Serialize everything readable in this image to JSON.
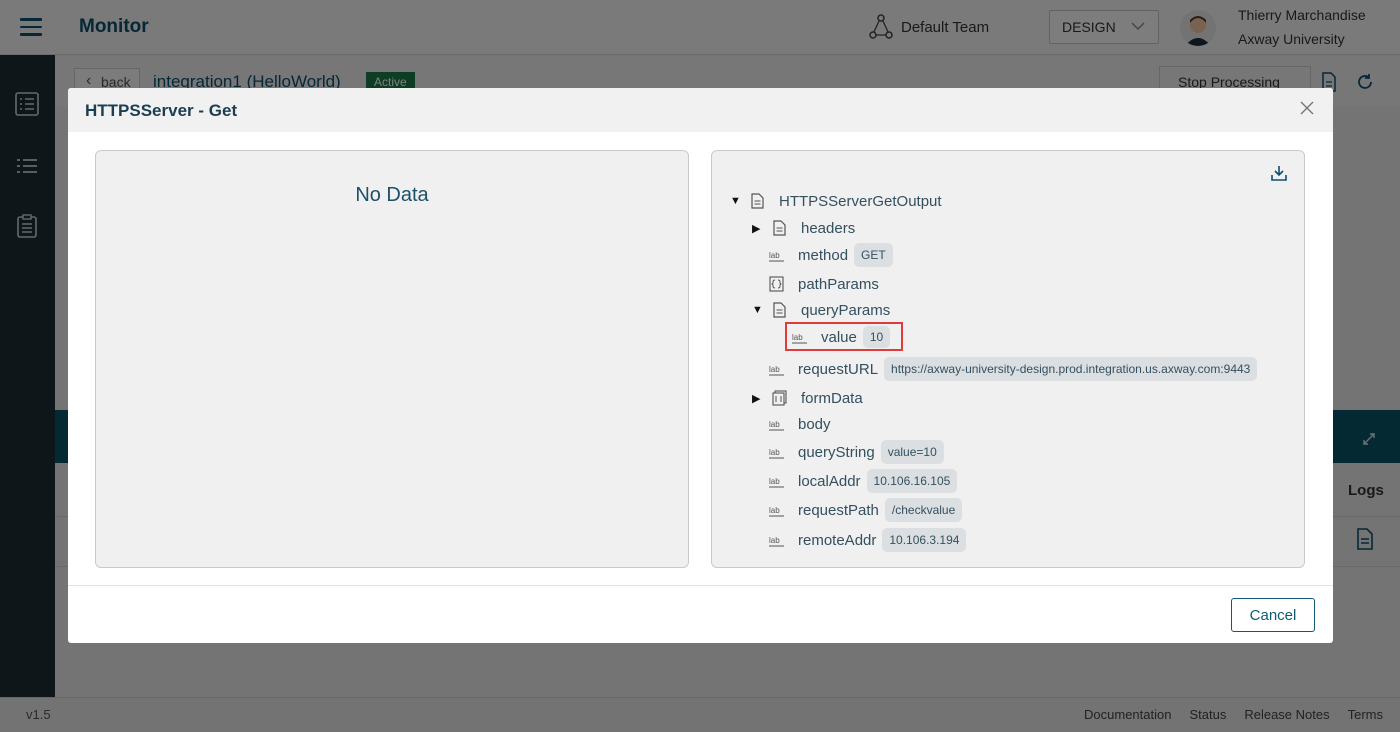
{
  "header": {
    "app_title": "Monitor",
    "team": "Default Team",
    "environment": "DESIGN",
    "user_name": "Thierry Marchandise",
    "user_org": "Axway University"
  },
  "subbar": {
    "back_label": "back",
    "integration_name": "integration1 (HelloWorld)",
    "status_badge": "Active",
    "stop_button": "Stop Processing"
  },
  "background": {
    "logs_tab": "Logs"
  },
  "footer": {
    "version": "v1.5",
    "links": [
      "Documentation",
      "Status",
      "Release Notes",
      "Terms"
    ]
  },
  "modal": {
    "title": "HTTPSServer - Get",
    "left_panel_message": "No Data",
    "cancel_label": "Cancel",
    "tree": {
      "root": "HTTPSServerGetOutput",
      "headers": "headers",
      "method": {
        "label": "method",
        "value": "GET"
      },
      "pathParams": "pathParams",
      "queryParams": "queryParams",
      "queryParams_value": {
        "label": "value",
        "value": "10"
      },
      "requestURL": {
        "label": "requestURL",
        "value": "https://axway-university-design.prod.integration.us.axway.com:9443"
      },
      "formData": "formData",
      "body": "body",
      "queryString": {
        "label": "queryString",
        "value": "value=10"
      },
      "localAddr": {
        "label": "localAddr",
        "value": "10.106.16.105"
      },
      "requestPath": {
        "label": "requestPath",
        "value": "/checkvalue"
      },
      "remoteAddr": {
        "label": "remoteAddr",
        "value": "10.106.3.194"
      }
    }
  }
}
